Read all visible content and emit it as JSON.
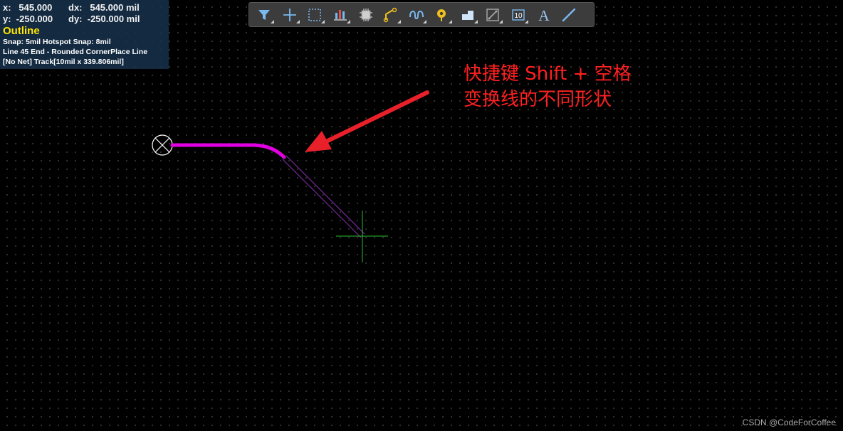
{
  "status": {
    "x_label": "x:",
    "x_value": "545.000",
    "dx_label": "dx:",
    "dx_value": "545.000 mil",
    "y_label": "y:",
    "y_value": "-250.000",
    "dy_label": "dy:",
    "dy_value": "-250.000 mil",
    "layer": "Outline",
    "snap": "Snap: 5mil Hotspot Snap: 8mil",
    "mode": "Line 45 End - Rounded CornerPlace Line",
    "net": "[No Net] Track[10mil x 339.806mil]"
  },
  "toolbar": {
    "buttons": [
      {
        "icon": "filter-icon"
      },
      {
        "icon": "crosshair-move-icon"
      },
      {
        "icon": "select-rect-icon"
      },
      {
        "icon": "align-icon"
      },
      {
        "icon": "component-icon"
      },
      {
        "icon": "route-track-icon"
      },
      {
        "icon": "tune-length-icon"
      },
      {
        "icon": "via-pad-icon"
      },
      {
        "icon": "polygon-fill-icon"
      },
      {
        "icon": "keepout-icon"
      },
      {
        "icon": "dimension-icon",
        "text": "10"
      },
      {
        "icon": "text-string-icon",
        "text": "A"
      },
      {
        "icon": "line-icon"
      }
    ]
  },
  "annotation": {
    "line1": "快捷键 Shift + 空格",
    "line2": "变换线的不同形状",
    "color": "#ff2020"
  },
  "track": {
    "color": "#e000e0",
    "preview_color": "#7a2a9a",
    "cursor_color": "#2ec02e"
  },
  "watermark": "CSDN @CodeForCoffee"
}
